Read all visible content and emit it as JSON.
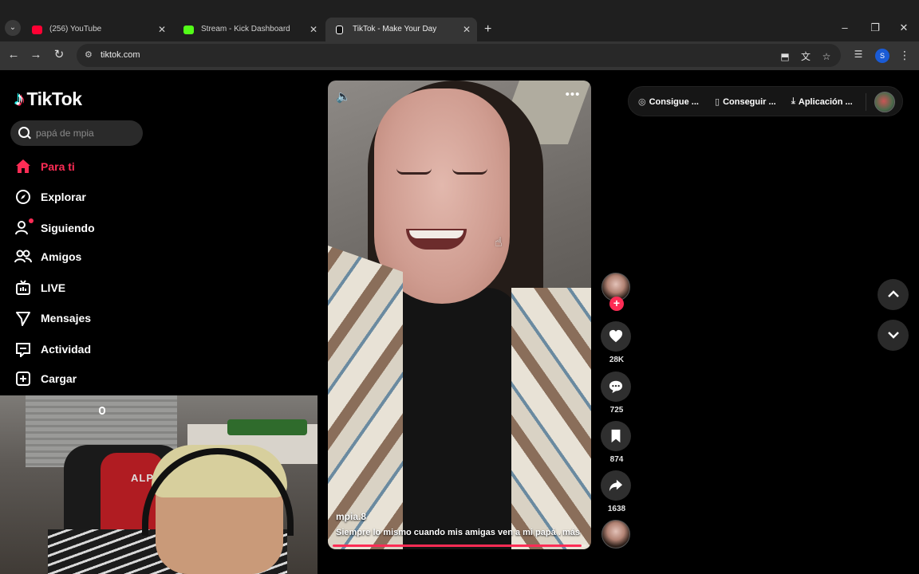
{
  "browser": {
    "tabs": [
      {
        "title": "(256) YouTube",
        "favicon_color": "#ff0033"
      },
      {
        "title": "Stream - Kick Dashboard",
        "favicon_color": "#53fc18"
      },
      {
        "title": "TikTok - Make Your Day",
        "favicon_color": "#000000",
        "active": true
      }
    ],
    "new_tab_label": "+",
    "url": "tiktok.com",
    "profile_initial": "S"
  },
  "tiktok": {
    "brand": "TikTok",
    "search_placeholder": "papá de mpia",
    "nav": [
      {
        "label": "Para ti",
        "icon": "home-icon",
        "active": true
      },
      {
        "label": "Explorar",
        "icon": "compass-icon"
      },
      {
        "label": "Siguiendo",
        "icon": "following-icon",
        "badge": true
      },
      {
        "label": "Amigos",
        "icon": "friends-icon"
      },
      {
        "label": "LIVE",
        "icon": "live-icon"
      },
      {
        "label": "Mensajes",
        "icon": "messages-icon"
      },
      {
        "label": "Actividad",
        "icon": "activity-icon"
      },
      {
        "label": "Cargar",
        "icon": "upload-icon"
      }
    ],
    "top_actions": {
      "coins": "Consigue ...",
      "get_app": "Conseguir ...",
      "desktop_app": "Aplicación ..."
    },
    "video": {
      "author": "mpia.8",
      "caption": "Siempre lo mismo cuando mis amigas ven a mi papá ...",
      "more": "más",
      "progress": 0.98
    },
    "actions": {
      "likes": "28K",
      "comments": "725",
      "saves": "874",
      "shares": "1638"
    }
  },
  "webcam": {
    "chair_text": "ALPI"
  },
  "colors": {
    "accent": "#fe2c55",
    "background": "#000000"
  }
}
